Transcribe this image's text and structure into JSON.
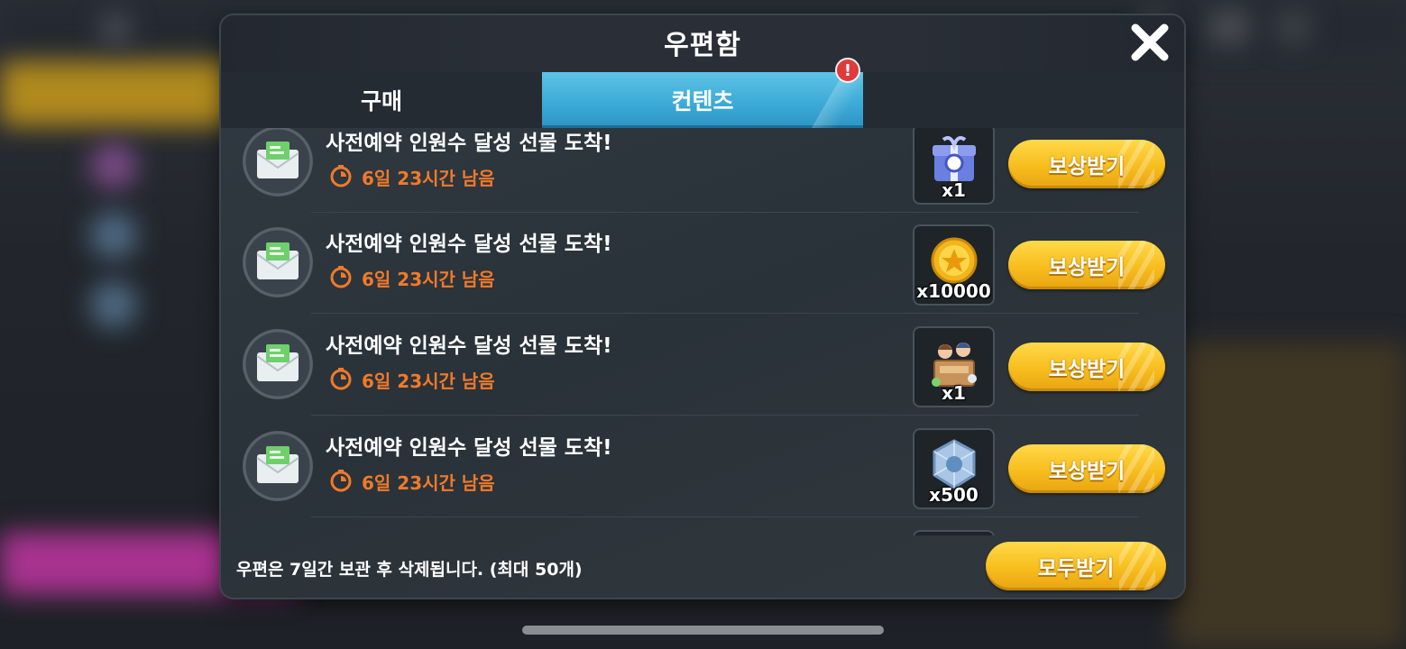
{
  "mailbox": {
    "title": "우편함",
    "tabs": [
      {
        "label": "구매",
        "active": false
      },
      {
        "label": "컨텐츠",
        "active": true,
        "alert": "!"
      }
    ],
    "items": [
      {
        "title": "사전예약 인원수 달성 선물 도착!",
        "time_left": "6일 23시간 남음",
        "reward_icon": "gift-box-icon",
        "reward_qty": "x1",
        "claim_label": "보상받기"
      },
      {
        "title": "사전예약 인원수 달성 선물 도착!",
        "time_left": "6일 23시간 남음",
        "reward_icon": "gold-coin-icon",
        "reward_qty": "x10000",
        "claim_label": "보상받기"
      },
      {
        "title": "사전예약 인원수 달성 선물 도착!",
        "time_left": "6일 23시간 남음",
        "reward_icon": "character-box-icon",
        "reward_qty": "x1",
        "claim_label": "보상받기"
      },
      {
        "title": "사전예약 인원수 달성 선물 도착!",
        "time_left": "6일 23시간 남음",
        "reward_icon": "crystal-gem-icon",
        "reward_qty": "x500",
        "claim_label": "보상받기"
      }
    ],
    "footer_note": "우편은 7일간 보관 후 삭제됩니다. (최대 50개)",
    "claim_all_label": "모두받기"
  },
  "colors": {
    "accent_tab": "#3aa9d6",
    "button_gold": "#f7bd1e",
    "timer_orange": "#f07a2a",
    "alert_red": "#e03a3a"
  }
}
